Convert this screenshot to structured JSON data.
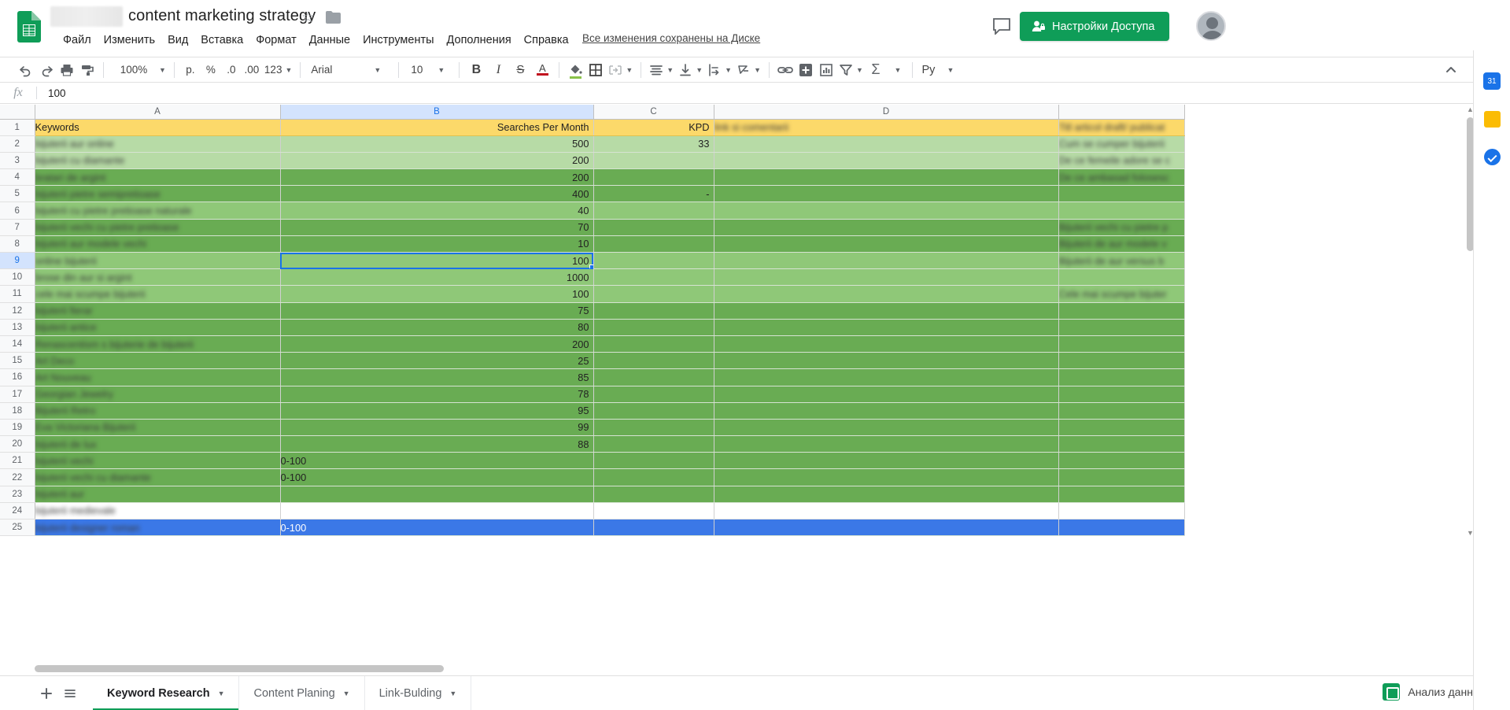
{
  "app": {
    "logo": "sheets-logo",
    "doc_title": "content marketing strategy",
    "star": "☆",
    "saved_note": "Все изменения сохранены на Диске",
    "share_label": "Настройки Доступа",
    "accent_green": "#0f9d58",
    "accent_blue": "#1a73e8",
    "header_fill": "#fcd96a"
  },
  "menu": {
    "items": [
      "Файл",
      "Изменить",
      "Вид",
      "Вставка",
      "Формат",
      "Данные",
      "Инструменты",
      "Дополнения",
      "Справка"
    ]
  },
  "toolbar": {
    "zoom": "100%",
    "currency": "p.",
    "percent": "%",
    "dec_less": ".0",
    "dec_more": ".00",
    "format_123": "123",
    "font_family": "Arial",
    "font_size": "10",
    "bold": "B",
    "italic": "I",
    "strike": "S",
    "text_color": "A",
    "functions": "Σ",
    "python": "Py"
  },
  "formula_bar": {
    "fx_label": "fx",
    "value": "100"
  },
  "grid": {
    "columns": [
      "A",
      "B",
      "C",
      "D"
    ],
    "selected_column": "B",
    "selected_cell": "B9",
    "headers": {
      "A": "Keywords",
      "B": "Searches Per Month",
      "C": "KPD",
      "D": "link si comentarii"
    },
    "rows": [
      {
        "n": "1",
        "a": "Keywords",
        "b": "Searches Per Month",
        "c": "KPD",
        "d": "link si comentarii",
        "e": "Titl  articol draft/ publicat",
        "fill": "header",
        "blur": false,
        "dblur": true
      },
      {
        "n": "2",
        "a": "bijuterii aur online",
        "b": "500",
        "c": "33",
        "d": "",
        "e": "Cum se cumper bijuterii",
        "fill": "light",
        "blur": true,
        "dblur": true
      },
      {
        "n": "3",
        "a": "bijuterii cu diamante",
        "b": "200",
        "c": "",
        "d": "",
        "e": "De ce femeile adore se c",
        "fill": "light",
        "blur": true,
        "dblur": true
      },
      {
        "n": "4",
        "a": "bratari de argint",
        "b": "200",
        "c": "",
        "d": "",
        "e": "De ce ambasad folosesc",
        "fill": "dark",
        "blur": true,
        "dblur": true
      },
      {
        "n": "5",
        "a": "bijuterii pietre semipretioase",
        "b": "400",
        "c": "-",
        "d": "",
        "e": "",
        "fill": "dark",
        "blur": true,
        "dblur": false
      },
      {
        "n": "6",
        "a": "bijuterii cu pietre pretioase naturale",
        "b": "40",
        "c": "",
        "d": "",
        "e": "",
        "fill": "mid",
        "blur": true,
        "dblur": false
      },
      {
        "n": "7",
        "a": "bijuterii vechi cu pietre pretioase",
        "b": "70",
        "c": "",
        "d": "",
        "e": "Bijuterii vechi cu pietre p",
        "fill": "dark",
        "blur": true,
        "dblur": true
      },
      {
        "n": "8",
        "a": "bijuterii aur modele vechi",
        "b": "10",
        "c": "",
        "d": "",
        "e": "Bijuterii de aur modele v",
        "fill": "dark",
        "blur": true,
        "dblur": true
      },
      {
        "n": "9",
        "a": "online bijuterii",
        "b": "100",
        "c": "",
        "d": "",
        "e": "Bijuterii de aur versus b",
        "fill": "mid",
        "blur": true,
        "dblur": true
      },
      {
        "n": "10",
        "a": "brose din aur si argint",
        "b": "1000",
        "c": "",
        "d": "",
        "e": "",
        "fill": "mid",
        "blur": true,
        "dblur": false
      },
      {
        "n": "11",
        "a": "cele mai scumpe bijuterii",
        "b": "100",
        "c": "",
        "d": "",
        "e": "Cele mai scumpe bijuter",
        "fill": "mid",
        "blur": true,
        "dblur": true
      },
      {
        "n": "12",
        "a": "bijuterii fierar",
        "b": "75",
        "c": "",
        "d": "",
        "e": "",
        "fill": "dark",
        "blur": true,
        "dblur": false
      },
      {
        "n": "13",
        "a": "bijuterii antice",
        "b": "80",
        "c": "",
        "d": "",
        "e": "",
        "fill": "dark",
        "blur": true,
        "dblur": false
      },
      {
        "n": "14",
        "a": "Renascentism s bijuterie de bijuterii",
        "b": "200",
        "c": "",
        "d": "",
        "e": "",
        "fill": "dark",
        "blur": true,
        "dblur": false
      },
      {
        "n": "15",
        "a": "Art Deco",
        "b": "25",
        "c": "",
        "d": "",
        "e": "",
        "fill": "dark",
        "blur": true,
        "dblur": false
      },
      {
        "n": "16",
        "a": "Art Nouveau",
        "b": "85",
        "c": "",
        "d": "",
        "e": "",
        "fill": "dark",
        "blur": true,
        "dblur": false
      },
      {
        "n": "17",
        "a": "Georgian Jewelry",
        "b": "78",
        "c": "",
        "d": "",
        "e": "",
        "fill": "dark",
        "blur": true,
        "dblur": false
      },
      {
        "n": "18",
        "a": "Bijuterii Retro",
        "b": "95",
        "c": "",
        "d": "",
        "e": "",
        "fill": "dark",
        "blur": true,
        "dblur": false
      },
      {
        "n": "19",
        "a": "Eva Victoriana Bijuterii",
        "b": "99",
        "c": "",
        "d": "",
        "e": "",
        "fill": "dark",
        "blur": true,
        "dblur": false
      },
      {
        "n": "20",
        "a": "bijuterii de lux",
        "b": "88",
        "c": "",
        "d": "",
        "e": "",
        "fill": "dark",
        "blur": true,
        "dblur": false
      },
      {
        "n": "21",
        "a": "bijuterii vechi",
        "b": "0-100",
        "c": "",
        "d": "",
        "e": "",
        "fill": "dark",
        "blur": true,
        "dblur": false,
        "bleft": true
      },
      {
        "n": "22",
        "a": "bijuterii vechi cu diamante",
        "b": "0-100",
        "c": "",
        "d": "",
        "e": "",
        "fill": "dark",
        "blur": true,
        "dblur": false,
        "bleft": true
      },
      {
        "n": "23",
        "a": "bijuterii aur",
        "b": "",
        "c": "",
        "d": "",
        "e": "",
        "fill": "dark",
        "blur": true,
        "dblur": false
      },
      {
        "n": "24",
        "a": "bijuterii medievale",
        "b": "",
        "c": "",
        "d": "",
        "e": "",
        "fill": "white",
        "blur": true,
        "dblur": false
      },
      {
        "n": "25",
        "a": "bijuterii designer roman",
        "b": "0-100",
        "c": "",
        "d": "",
        "e": "",
        "fill": "selected",
        "blur": true,
        "dblur": false,
        "bleft": true
      }
    ]
  },
  "sheet_tabs": {
    "add_label": "+",
    "all_sheets_label": "≡",
    "tabs": [
      {
        "label": "Keyword Research",
        "active": true
      },
      {
        "label": "Content Planing",
        "active": false
      },
      {
        "label": "Link-Bulding",
        "active": false
      }
    ]
  },
  "explore": {
    "label": "Анализ данных"
  },
  "sidebar": {
    "items": [
      {
        "name": "calendar-icon",
        "glyph": "31"
      },
      {
        "name": "keep-icon",
        "glyph": ""
      },
      {
        "name": "tasks-icon",
        "glyph": ""
      }
    ]
  }
}
